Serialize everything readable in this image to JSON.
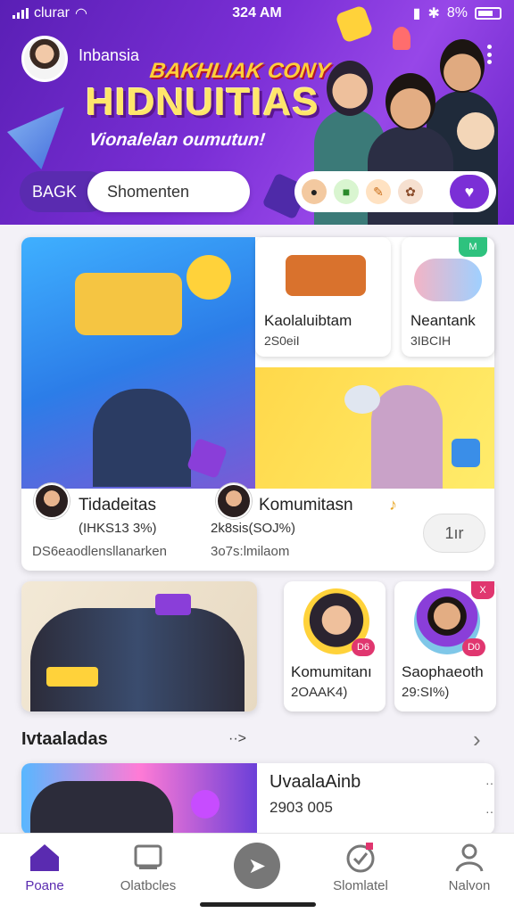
{
  "status": {
    "carrier": "clurar",
    "time": "324 AM",
    "battery": "8%"
  },
  "header": {
    "user_name": "Inbansia",
    "kicker": "BAKHLIAK CONY",
    "title": "HIDNUITIAS",
    "subtitle": "Vionalelan oumutun!"
  },
  "search": {
    "back_label": "BAGK",
    "placeholder": "Shomenten"
  },
  "feature": {
    "mini1": {
      "title": "Kaolaluibtam",
      "meta": "2S0eiI"
    },
    "mini2": {
      "title": "Neantank",
      "meta": "3IBCIH",
      "tag": "M"
    },
    "left_item": {
      "title": "Tidadeitas",
      "meta": "(IHKS13 3%)",
      "desc": "DS6eaodlensllanarken"
    },
    "right_item": {
      "title": "Komumitasn",
      "meta": "2k8sis(SOJ%)",
      "desc": "3o7s:lmilaom"
    },
    "play_label": "1ır"
  },
  "row2": {
    "card1": {
      "title": "Komumitanı",
      "meta": "2OAAK4)",
      "badge": "D6"
    },
    "card2": {
      "title": "Saophaeoth",
      "meta": "29:SI%)",
      "badge": "D0",
      "tag": "X"
    }
  },
  "section": {
    "title": "Ivtaaladas",
    "more": "··>",
    "chevron": "›"
  },
  "feed": {
    "title": "UvaalaAinb",
    "meta": "2903 005"
  },
  "nav": [
    {
      "label": "Poane"
    },
    {
      "label": "Olatbcles"
    },
    {
      "label": ""
    },
    {
      "label": "Slomlatel"
    },
    {
      "label": "Nalvon"
    }
  ]
}
